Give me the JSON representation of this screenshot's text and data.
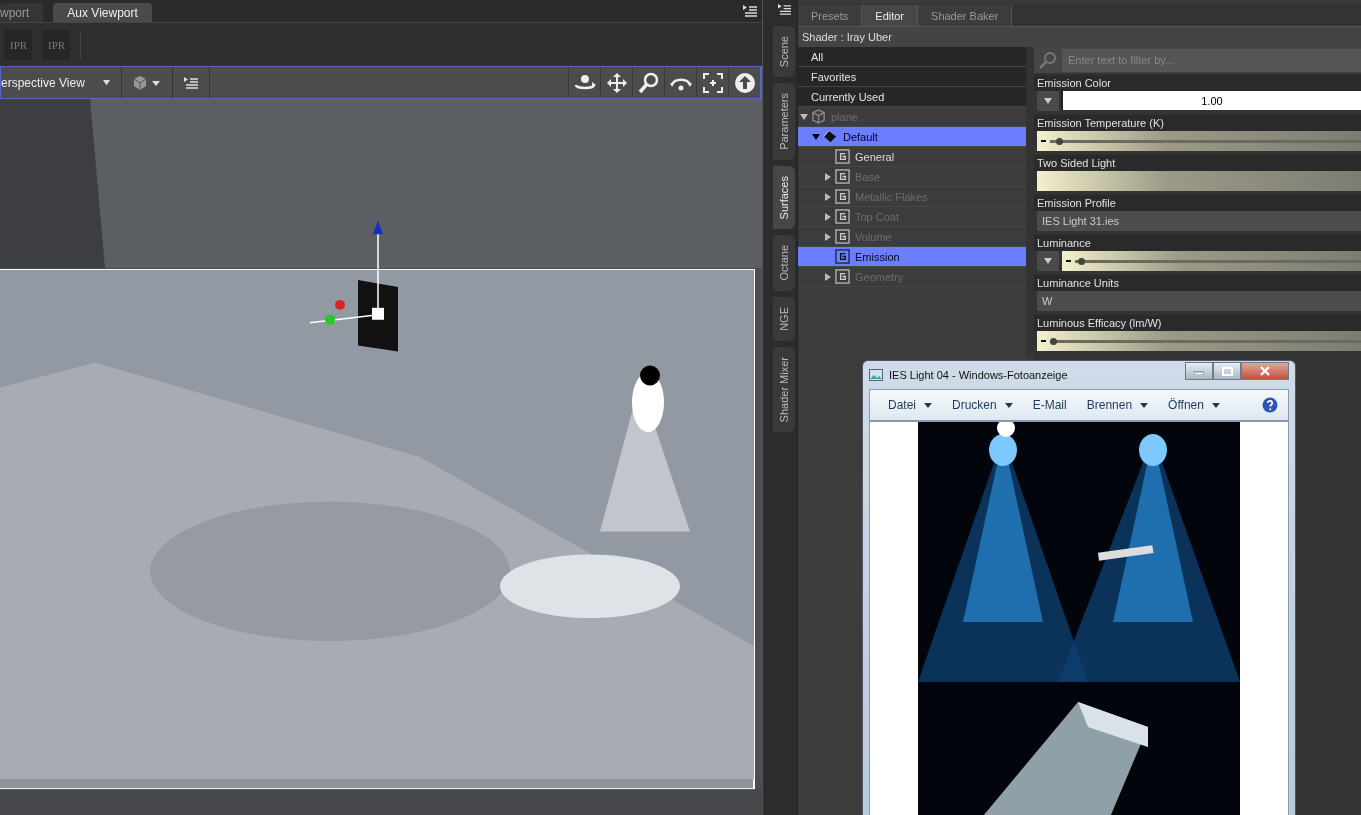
{
  "viewport_pane": {
    "tabs": [
      {
        "label": "wport",
        "selected": false
      },
      {
        "label": "Aux Viewport",
        "selected": true
      }
    ],
    "render_buttons": [
      {
        "label": "IPR",
        "disabled": true
      },
      {
        "label": "IPR",
        "disabled": true
      }
    ],
    "view_selector": {
      "value": "erspective View"
    }
  },
  "side_tabs": [
    {
      "label": "Scene",
      "selected": false
    },
    {
      "label": "Parameters",
      "selected": false
    },
    {
      "label": "Surfaces",
      "selected": true
    },
    {
      "label": "Octane",
      "selected": false
    },
    {
      "label": "NGE",
      "selected": false
    },
    {
      "label": "Shader Mixer",
      "selected": false
    }
  ],
  "surfaces_pane": {
    "tabs": [
      {
        "label": "Presets",
        "selected": false
      },
      {
        "label": "Editor",
        "selected": true
      },
      {
        "label": "Shader Baker",
        "selected": false
      }
    ],
    "shader_label": "Shader : Iray Uber",
    "filters": [
      {
        "label": "All"
      },
      {
        "label": "Favorites"
      },
      {
        "label": "Currently Used"
      }
    ],
    "tree": [
      {
        "label": "plane",
        "kind": "object",
        "expandable": true,
        "expanded": true,
        "dim": true,
        "selected": false,
        "children": [
          {
            "label": "Default",
            "kind": "material",
            "expandable": true,
            "expanded": true,
            "dim": false,
            "selected": true,
            "children": [
              {
                "label": "General",
                "kind": "group",
                "expandable": false,
                "dim": false,
                "selected": false
              },
              {
                "label": "Base",
                "kind": "group",
                "expandable": true,
                "expanded": false,
                "dim": true,
                "selected": false
              },
              {
                "label": "Metallic Flakes",
                "kind": "group",
                "expandable": true,
                "expanded": false,
                "dim": true,
                "selected": false
              },
              {
                "label": "Top Coat",
                "kind": "group",
                "expandable": true,
                "expanded": false,
                "dim": true,
                "selected": false
              },
              {
                "label": "Volume",
                "kind": "group",
                "expandable": true,
                "expanded": false,
                "dim": true,
                "selected": false
              },
              {
                "label": "Emission",
                "kind": "group",
                "expandable": false,
                "dim": false,
                "selected": true
              },
              {
                "label": "Geometry",
                "kind": "group",
                "expandable": true,
                "expanded": false,
                "dim": true,
                "selected": false
              }
            ]
          }
        ]
      }
    ],
    "filter_field": {
      "placeholder": "Enter text to filter by..."
    },
    "properties": [
      {
        "label": "Emission Color",
        "kind": "color",
        "value": "1.00"
      },
      {
        "label": "Emission Temperature (K)",
        "kind": "slider",
        "level": 0.02
      },
      {
        "label": "Two Sided Light",
        "kind": "bar"
      },
      {
        "label": "Emission Profile",
        "kind": "file",
        "value": "IES Light 31.ies"
      },
      {
        "label": "Luminance",
        "kind": "menu-slider",
        "level": 0.01
      },
      {
        "label": "Luminance Units",
        "kind": "menu",
        "value": "W"
      },
      {
        "label": "Luminous Efficacy (lm/W)",
        "kind": "slider",
        "level": 0.0
      }
    ]
  },
  "photo_viewer": {
    "title": "IES Light 04 - Windows-Fotoanzeige",
    "menu": [
      {
        "label": "Datei",
        "dropdown": true
      },
      {
        "label": "Drucken",
        "dropdown": true
      },
      {
        "label": "E-Mail",
        "dropdown": false
      },
      {
        "label": "Brennen",
        "dropdown": true
      },
      {
        "label": "Öffnen",
        "dropdown": true
      }
    ]
  }
}
